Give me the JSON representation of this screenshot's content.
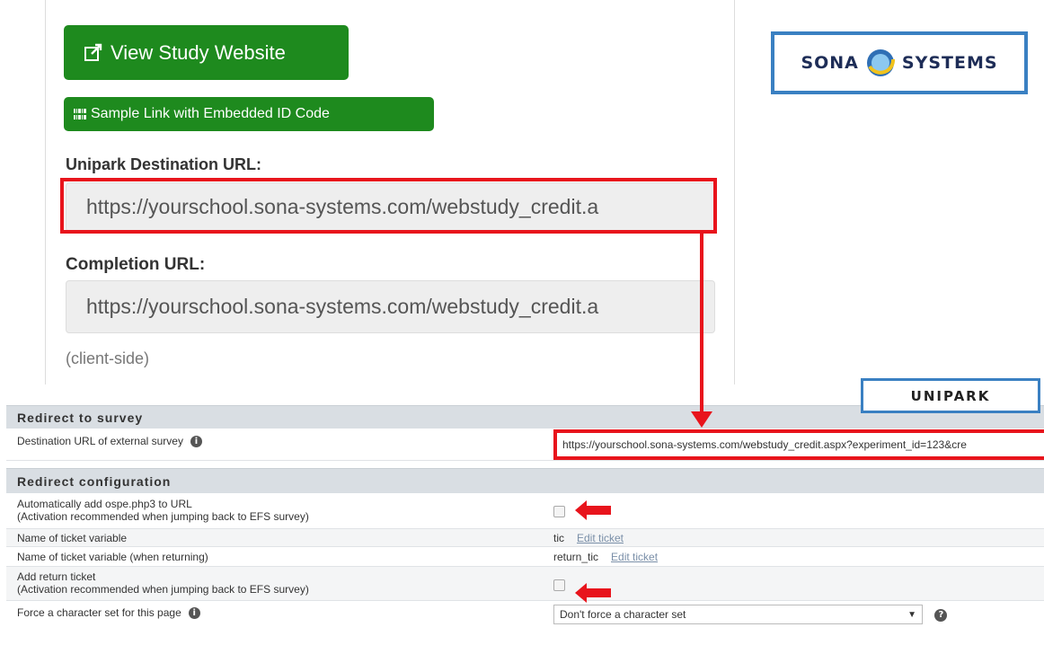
{
  "sona": {
    "view_button": "View Study Website",
    "sample_button": "Sample Link with Embedded ID Code",
    "destination_label": "Unipark Destination URL:",
    "destination_url": "https://yourschool.sona-systems.com/webstudy_credit.a",
    "completion_label": "Completion URL:",
    "completion_url": "https://yourschool.sona-systems.com/webstudy_credit.a",
    "client_side": "(client-side)",
    "logo_left": "SONA",
    "logo_right": "SYSTEMS"
  },
  "unipark": {
    "logo": "UNIPARK",
    "section_redirect": "Redirect to survey",
    "destination_label": "Destination URL of external survey",
    "destination_value": "https://yourschool.sona-systems.com/webstudy_credit.aspx?experiment_id=123&cre",
    "section_config": "Redirect configuration",
    "auto_add_label": "Automatically add ospe.php3 to URL",
    "auto_add_sub": "(Activation recommended when jumping back to EFS survey)",
    "ticket_var_label": "Name of ticket variable",
    "ticket_var_value": "tic",
    "edit_ticket": "Edit ticket",
    "ticket_var_return_label": "Name of ticket variable (when returning)",
    "ticket_var_return_value": "return_tic",
    "return_ticket_label": "Add return ticket",
    "return_ticket_sub": "(Activation recommended when jumping back to EFS survey)",
    "charset_label": "Force a character set for this page",
    "charset_value": "Don't force a character set"
  },
  "colors": {
    "button_green": "#1e8a1e",
    "highlight_red": "#e8141c",
    "logo_blue": "#3a80c2"
  }
}
